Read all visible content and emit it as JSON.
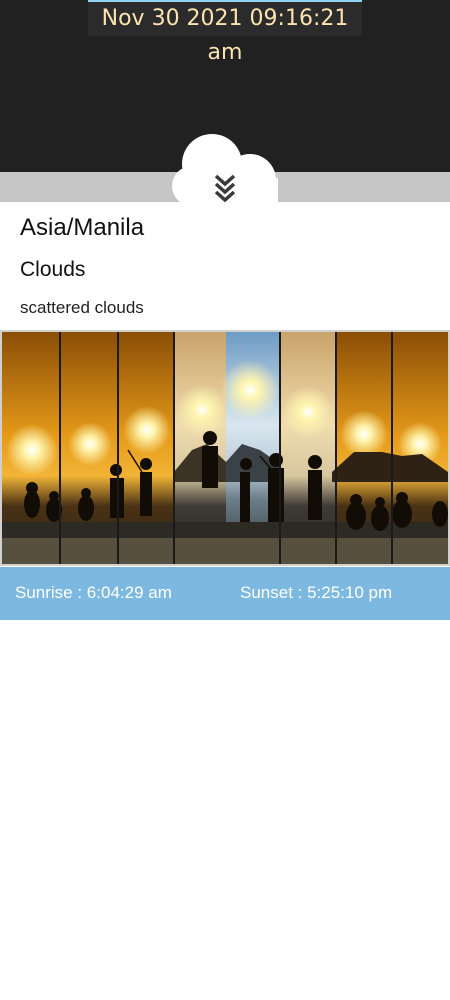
{
  "datetime": "Nov 30 2021 09:16:21 am",
  "location": "Asia/Manila",
  "weather": {
    "main": "Clouds",
    "description": "scattered clouds",
    "icon": "cloud-icon"
  },
  "collapse_icon": "double-chevron-down-icon",
  "sun": {
    "sunrise_label": "Sunrise : 6:04:29 am",
    "sunset_label": "Sunset : 5:25:10 pm"
  },
  "colors": {
    "top_background": "#212121",
    "datetime_text": "#fde3b0",
    "sun_bar": "#7db8e0"
  }
}
